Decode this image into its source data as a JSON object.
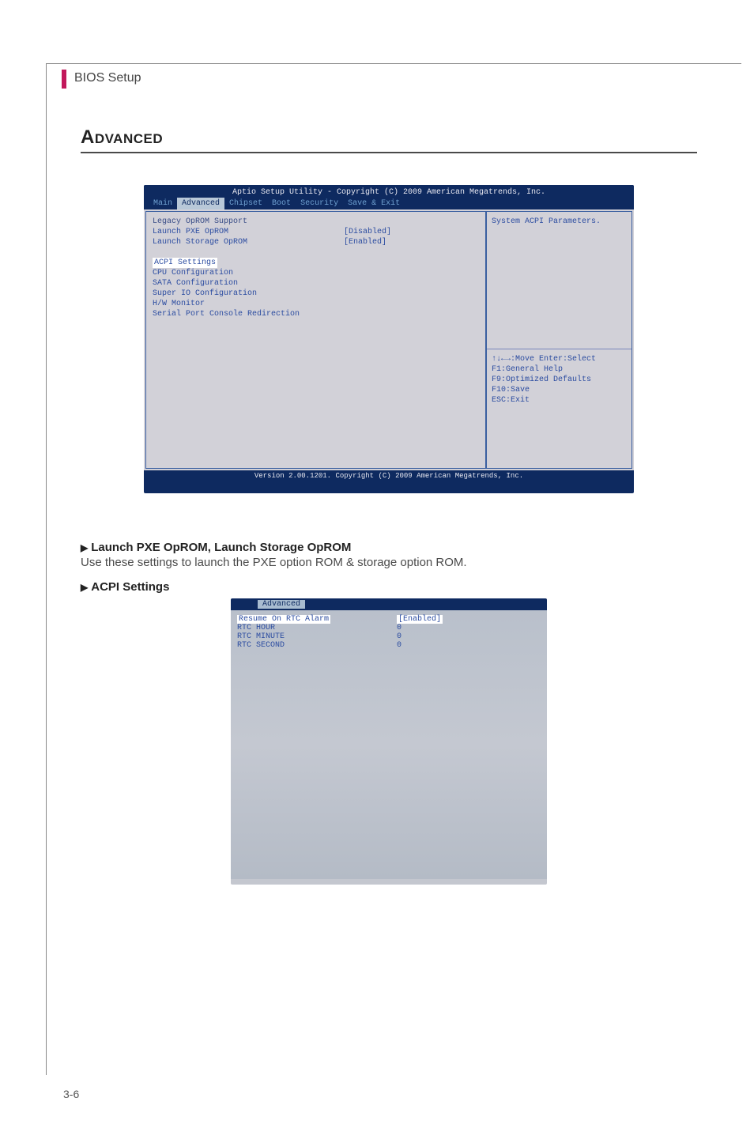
{
  "page": {
    "tab": "BIOS Setup",
    "number": "3-6"
  },
  "section": {
    "title": "Advanced"
  },
  "bios1": {
    "top": "Aptio Setup Utility - Copyright (C) 2009 American Megatrends, Inc.",
    "tabs": [
      "Main",
      "Advanced",
      "Chipset",
      "Boot",
      "Security",
      "Save & Exit"
    ],
    "left": {
      "group": "Legacy OpROM Support",
      "items": [
        {
          "label": "Launch PXE OpROM",
          "value": "[Disabled]"
        },
        {
          "label": "Launch Storage OpROM",
          "value": "[Enabled]"
        }
      ],
      "highlighted": "ACPI Settings",
      "rest": [
        "CPU Configuration",
        "SATA Configuration",
        "Super IO Configuration",
        "H/W Monitor",
        "Serial Port Console Redirection"
      ]
    },
    "right": {
      "desc": "System ACPI Parameters.",
      "keys": [
        "↑↓←→:Move  Enter:Select",
        "F1:General Help",
        "F9:Optimized Defaults",
        "F10:Save",
        "ESC:Exit"
      ]
    },
    "bottom": "Version 2.00.1201. Copyright (C) 2009 American Megatrends, Inc."
  },
  "text": {
    "h1": "Launch PXE OpROM, Launch Storage OpROM",
    "p1": "Use these settings to launch the PXE option ROM & storage option ROM.",
    "h2": "ACPI Settings"
  },
  "bios2": {
    "tab": "Advanced",
    "rows": [
      {
        "label": "Resume On RTC Alarm",
        "value": "[Enabled]"
      },
      {
        "label": "RTC HOUR",
        "value": "0"
      },
      {
        "label": "RTC MINUTE",
        "value": "0"
      },
      {
        "label": "RTC SECOND",
        "value": "0"
      }
    ]
  }
}
